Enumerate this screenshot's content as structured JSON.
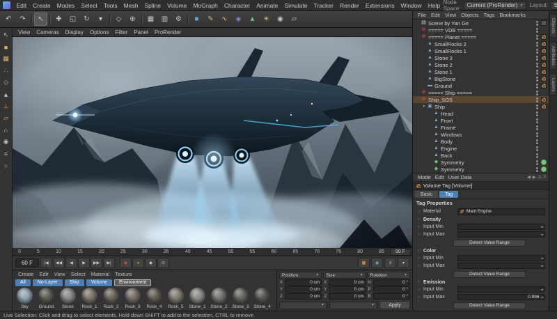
{
  "menubar": {
    "items": [
      "Edit",
      "Create",
      "Modes",
      "Select",
      "Tools",
      "Mesh",
      "Spline",
      "Volume",
      "MoGraph",
      "Character",
      "Animate",
      "Simulate",
      "Tracker",
      "Render",
      "Extensions",
      "Window",
      "Help"
    ],
    "node_space_label": "Node Space:",
    "node_space_value": "Current (ProRender)",
    "layout_label": "Layout:",
    "layout_value": "Startup"
  },
  "toolbar": {
    "icons": [
      {
        "g": "↶",
        "n": "undo-icon"
      },
      {
        "g": "↷",
        "n": "redo-icon"
      },
      {
        "g": "",
        "n": "separator",
        "cls": "sep"
      },
      {
        "g": "↖",
        "n": "live-selection-icon",
        "sel": true
      },
      {
        "g": "",
        "n": "separator",
        "cls": "sep"
      },
      {
        "g": "✚",
        "n": "move-tool-icon"
      },
      {
        "g": "◱",
        "n": "scale-tool-icon"
      },
      {
        "g": "↻",
        "n": "rotate-tool-icon"
      },
      {
        "g": "▾",
        "n": "last-tool-icon"
      },
      {
        "g": "",
        "n": "separator",
        "cls": "sep"
      },
      {
        "g": "◇",
        "n": "coordinate-system-icon"
      },
      {
        "g": "⊕",
        "n": "global-axis-icon"
      },
      {
        "g": "",
        "n": "separator",
        "cls": "sep"
      },
      {
        "g": "▦",
        "n": "render-view-icon"
      },
      {
        "g": "▥",
        "n": "render-picture-viewer-icon"
      },
      {
        "g": "⚙",
        "n": "render-settings-icon"
      },
      {
        "g": "",
        "n": "separator",
        "cls": "sep"
      },
      {
        "g": "■",
        "n": "modeling-objects-icon",
        "color": "#5ea8d8"
      },
      {
        "g": "✎",
        "n": "pen-icon",
        "color": "#d8b26a"
      },
      {
        "g": "∿",
        "n": "spline-icon",
        "color": "#d8b26a"
      },
      {
        "g": "◈",
        "n": "volume-icon",
        "color": "#9a86d8"
      },
      {
        "g": "▲",
        "n": "generators-icon",
        "color": "#6fc07a"
      },
      {
        "g": "☀",
        "n": "light-icon",
        "color": "#e0c06a"
      },
      {
        "g": "◉",
        "n": "camera-icon"
      },
      {
        "g": "▱",
        "n": "environment-icon"
      }
    ],
    "right_icons": [
      {
        "g": "◧",
        "n": "layout-left-icon"
      },
      {
        "g": "◨",
        "n": "layout-right-icon"
      },
      {
        "g": "▥",
        "n": "panel-columns-icon"
      },
      {
        "g": "⊞",
        "n": "grid-toggle-icon",
        "color": "#e8a33d"
      },
      {
        "g": "◫",
        "n": "split-view-icon"
      }
    ]
  },
  "leftbar": {
    "icons": [
      {
        "g": "↖",
        "n": "select-tool-icon"
      },
      {
        "g": "■",
        "n": "model-mode-icon",
        "color": "#d8b26a"
      },
      {
        "g": "▦",
        "n": "texture-mode-icon",
        "color": "#d8b26a"
      },
      {
        "g": "∴",
        "n": "points-mode-icon"
      },
      {
        "g": "◇",
        "n": "edge-mode-icon"
      },
      {
        "g": "▲",
        "n": "polygon-mode-icon"
      },
      {
        "g": "⊥",
        "n": "enable-axis-icon",
        "color": "#e8a33d"
      },
      {
        "g": "▱",
        "n": "workplane-icon",
        "color": "#e8a33d"
      },
      {
        "g": "∩",
        "n": "snap-icon"
      },
      {
        "g": "◉",
        "n": "viewport-solo-icon"
      },
      {
        "g": "≡",
        "n": "tweak-mode-icon"
      },
      {
        "g": "○",
        "n": "locked-workplane-icon"
      }
    ]
  },
  "viewport": {
    "menus": [
      "View",
      "Cameras",
      "Display",
      "Options",
      "Filter",
      "Panel",
      "ProRender"
    ]
  },
  "timeline": {
    "ticks": [
      "0",
      "5",
      "10",
      "15",
      "20",
      "25",
      "30",
      "35",
      "40",
      "45",
      "50",
      "55",
      "60",
      "65",
      "70",
      "75",
      "80",
      "85"
    ],
    "end_label": "90 F",
    "current_frame": "60 F"
  },
  "transport": {
    "buttons": [
      {
        "g": "|◀",
        "n": "goto-start-button"
      },
      {
        "g": "◀◀",
        "n": "previous-key-button"
      },
      {
        "g": "◀",
        "n": "previous-frame-button"
      },
      {
        "g": "▶",
        "n": "play-button"
      },
      {
        "g": "▶▶",
        "n": "next-frame-button"
      },
      {
        "g": "▶|",
        "n": "goto-end-button"
      }
    ],
    "record_buttons": [
      {
        "g": "◉",
        "n": "record-keyframe-button",
        "color": "#d05050"
      },
      {
        "g": "●",
        "n": "autokey-button",
        "color": "#c8a13e"
      },
      {
        "g": "◆",
        "n": "keyframe-selection-button"
      },
      {
        "g": "⊙",
        "n": "keyframe-options-button"
      }
    ],
    "right_icons": [
      {
        "g": "▦",
        "n": "timeline-mode-icon",
        "color": "#e8a33d"
      },
      {
        "g": "◉",
        "n": "sound-toggle-icon",
        "color": "#6fb3e0"
      },
      {
        "g": "≡",
        "n": "playback-options-icon"
      },
      {
        "g": "▾",
        "n": "frame-rate-icon"
      }
    ]
  },
  "materials": {
    "menus": [
      "Create",
      "Edit",
      "View",
      "Select",
      "Material",
      "Texture"
    ],
    "layers": [
      {
        "label": "All",
        "bg": "#4f7fb2"
      },
      {
        "label": "No-Layer",
        "bg": "#4f7fb2"
      },
      {
        "label": "Ship",
        "bg": "#4f7fb2"
      },
      {
        "label": "Volume",
        "bg": "#4f7fb2"
      },
      {
        "label": "Environment",
        "bg": "#5e5e5e",
        "sel": true
      }
    ],
    "items": [
      {
        "name": "Sky",
        "color": "#93a7b4"
      },
      {
        "name": "Ground",
        "color": "#5d5b52"
      },
      {
        "name": "Stone",
        "color": "#8a8a86"
      },
      {
        "name": "Rock_1",
        "color": "#7b746a"
      },
      {
        "name": "Rock_2",
        "color": "#6a645c"
      },
      {
        "name": "Rock_3",
        "color": "#756f66"
      },
      {
        "name": "Rock_4",
        "color": "#5f5952"
      },
      {
        "name": "Rock_5",
        "color": "#827c72"
      },
      {
        "name": "Stone_1",
        "color": "#8d8d89"
      },
      {
        "name": "Stone_2",
        "color": "#74746f"
      },
      {
        "name": "Stone_3",
        "color": "#64645f"
      },
      {
        "name": "Stone_4",
        "color": "#55554f"
      }
    ]
  },
  "coords": {
    "headers": [
      "Position",
      "Size",
      "Rotation"
    ],
    "rows": [
      {
        "l1": "X",
        "v1": "0 cm",
        "l2": "X",
        "v2": "0 cm",
        "l3": "H",
        "v3": "0 °"
      },
      {
        "l1": "Y",
        "v1": "0 cm",
        "l2": "Y",
        "v2": "0 cm",
        "l3": "P",
        "v3": "0 °"
      },
      {
        "l1": "Z",
        "v1": "0 cm",
        "l2": "Z",
        "v2": "0 cm",
        "l3": "B",
        "v3": "0 °"
      }
    ],
    "apply_label": "Apply"
  },
  "object_manager": {
    "menus": [
      "File",
      "Edit",
      "View",
      "Objects",
      "Tags",
      "Bookmarks"
    ],
    "tree": [
      {
        "label": "Scene by Yan Ge",
        "ind": 0,
        "icon": "▤",
        "color": "#c9ced3",
        "tag": "dark"
      },
      {
        "label": "===== VDB =====",
        "ind": 0,
        "icon": "⊘",
        "color": "#e05a5a",
        "tag": "none"
      },
      {
        "label": "===== Planet =====",
        "ind": 0,
        "icon": "⊘",
        "color": "#e05a5a",
        "tag": "mat"
      },
      {
        "label": "SmallRocks 2",
        "ind": 1,
        "icon": "▲",
        "color": "#7fa6c8",
        "tag": "mat"
      },
      {
        "label": "SmallRocks 1",
        "ind": 1,
        "icon": "▲",
        "color": "#7fa6c8",
        "tag": "mat"
      },
      {
        "label": "Stone 3",
        "ind": 1,
        "icon": "▲",
        "color": "#7fa6c8",
        "tag": "mat"
      },
      {
        "label": "Stone 2",
        "ind": 1,
        "icon": "▲",
        "color": "#7fa6c8",
        "tag": "mat"
      },
      {
        "label": "Stone 1",
        "ind": 1,
        "icon": "▲",
        "color": "#7fa6c8",
        "tag": "mat"
      },
      {
        "label": "BigStone",
        "ind": 1,
        "icon": "▲",
        "color": "#7fa6c8",
        "tag": "mat"
      },
      {
        "label": "Ground",
        "ind": 1,
        "icon": "▬",
        "color": "#7fa6c8",
        "tag": "mat"
      },
      {
        "label": "===== Ship =====",
        "ind": 0,
        "icon": "⊘",
        "color": "#e05a5a",
        "tag": "none"
      },
      {
        "label": "Ship_SOS",
        "ind": 0,
        "icon": "⊘",
        "color": "#e05a5a",
        "tag": "mat",
        "sel": true
      },
      {
        "label": "Ship",
        "ind": 1,
        "icon": "▣",
        "color": "#7fa6c8",
        "tag": "mat",
        "exp": true
      },
      {
        "label": "Head",
        "ind": 2,
        "icon": "▲",
        "color": "#7fa6c8",
        "tag": "none"
      },
      {
        "label": "Front",
        "ind": 2,
        "icon": "▲",
        "color": "#7fa6c8",
        "tag": "none"
      },
      {
        "label": "Frame",
        "ind": 2,
        "icon": "▲",
        "color": "#7fa6c8",
        "tag": "none"
      },
      {
        "label": "Windows",
        "ind": 2,
        "icon": "▲",
        "color": "#7fa6c8",
        "tag": "none"
      },
      {
        "label": "Body",
        "ind": 2,
        "icon": "▲",
        "color": "#7fa6c8",
        "tag": "none"
      },
      {
        "label": "Engine",
        "ind": 2,
        "icon": "▲",
        "color": "#7fa6c8",
        "tag": "none"
      },
      {
        "label": "Back",
        "ind": 2,
        "icon": "▲",
        "color": "#7fa6c8",
        "tag": "none"
      },
      {
        "label": "Symmetry",
        "ind": 2,
        "icon": "◆",
        "color": "#74c572",
        "tag": "green"
      },
      {
        "label": "Symmetry",
        "ind": 2,
        "icon": "◆",
        "color": "#74c572",
        "tag": "green"
      }
    ]
  },
  "attributes": {
    "menus": [
      "Mode",
      "Edit",
      "User Data"
    ],
    "right_icons": [
      {
        "g": "◀",
        "n": "attr-back-icon"
      },
      {
        "g": "▶",
        "n": "attr-forward-icon"
      },
      {
        "g": "⊙",
        "n": "attr-lock-icon"
      },
      {
        "g": "≡",
        "n": "attr-menu-icon"
      }
    ],
    "title": "Volume Tag [Volume]",
    "tabs": [
      {
        "label": "Basic"
      },
      {
        "label": "Tag",
        "sel": true
      }
    ],
    "section": "Tag Properties",
    "material_label": "Material",
    "material_value": "Main Engine",
    "rows": [
      {
        "t": "sec",
        "label": "Density"
      },
      {
        "t": "inp",
        "label": "Input Min",
        "value": ""
      },
      {
        "t": "inp",
        "label": "Input Max",
        "value": ""
      },
      {
        "t": "btn",
        "label": "Detect Value Range"
      },
      {
        "t": "sec",
        "label": "Color"
      },
      {
        "t": "inp",
        "label": "Input Min",
        "value": ""
      },
      {
        "t": "inp",
        "label": "Input Max",
        "value": ""
      },
      {
        "t": "btn",
        "label": "Detect Value Range"
      },
      {
        "t": "sec",
        "label": "Emission"
      },
      {
        "t": "inp",
        "label": "Input Min",
        "value": ""
      },
      {
        "t": "inp",
        "label": "Input Max",
        "value": "0.996"
      },
      {
        "t": "btn",
        "label": "Detect Value Range"
      }
    ]
  },
  "right_strip": {
    "tabs": [
      "Objects",
      "Attributes",
      "Layers"
    ]
  },
  "statusbar": {
    "text": "Live Selection: Click and drag to select elements. Hold down SHIFT to add to the selection, CTRL to remove."
  }
}
